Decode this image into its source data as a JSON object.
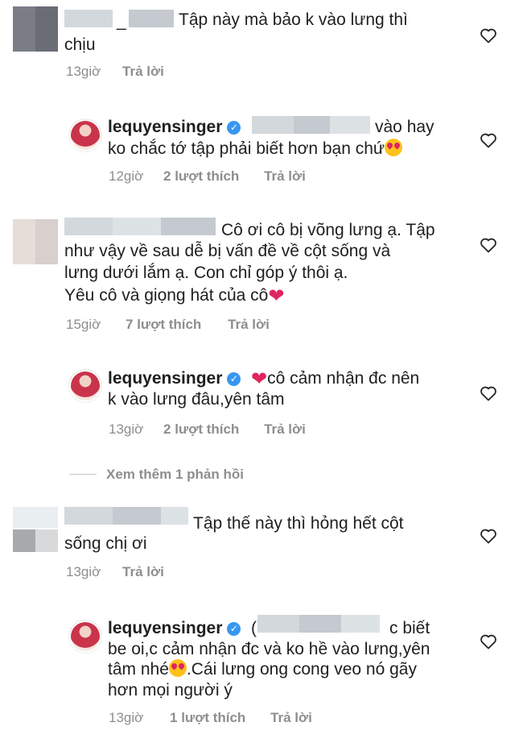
{
  "comments": [
    {
      "username_tail": "_",
      "text_line1": "Tập này mà bảo k vào lưng thì",
      "text_line2": "chịu",
      "time": "13giờ",
      "reply_label": "Trả lời"
    },
    {
      "username": "lequyensinger",
      "text_line1": "vào hay",
      "text_line2": "ko chắc tớ tập phải biết hơn bạn chứ",
      "time": "12giờ",
      "likes": "2 lượt thích",
      "reply_label": "Trả lời"
    },
    {
      "text_line1": "Cô ơi cô bị võng lưng ạ. Tập",
      "text_line2": "như vậy về sau dễ bị vấn đề về cột sống và",
      "text_line3": "lưng dưới lắm ạ. Con chỉ góp ý thôi ạ.",
      "text_line4": "Yêu cô và giọng hát của cô",
      "time": "15giờ",
      "likes": "7 lượt thích",
      "reply_label": "Trả lời"
    },
    {
      "username": "lequyensinger",
      "text_line1": "cô cảm nhận đc nên",
      "text_line2": "k vào lưng đâu,yên tâm",
      "time": "13giờ",
      "likes": "2 lượt thích",
      "reply_label": "Trả lời"
    },
    {
      "text_line1": "Tập thế này thì hỏng hết cột",
      "text_line2": "sống chị ơi",
      "time": "13giờ",
      "reply_label": "Trả lời"
    },
    {
      "username": "lequyensinger",
      "text_prefix": "(",
      "text_line1": "c biết",
      "text_line2": "be oi,c cảm nhận đc và ko hề vào lưng,yên",
      "text_line3a": "tâm nhé",
      "text_line3b": ".Cái lưng ong cong veo nó gãy",
      "text_line4": "hơn mọi người ý",
      "time": "13giờ",
      "likes": "1 lượt thích",
      "reply_label": "Trả lời"
    }
  ],
  "view_more": "Xem thêm 1 phản hồi",
  "colors": {
    "muted": "#8e8e8e",
    "verified": "#3897f0",
    "heart": "#e0245e"
  },
  "icons": {
    "like": "heart-outline-icon",
    "verified": "verified-badge-icon"
  }
}
